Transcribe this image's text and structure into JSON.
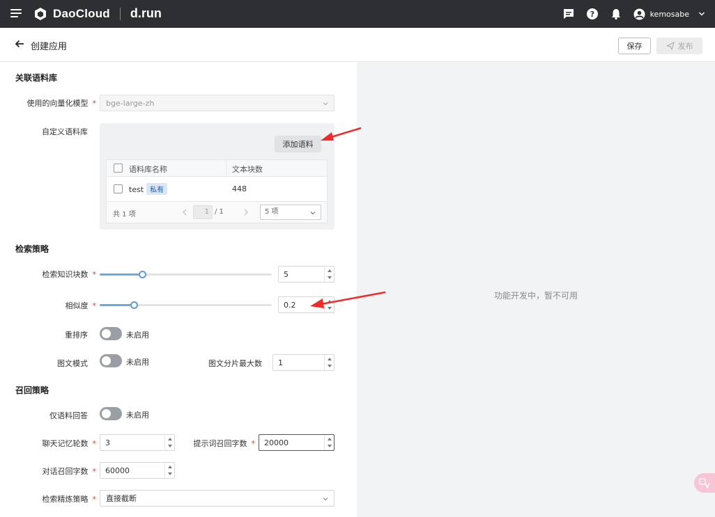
{
  "topbar": {
    "brand": "DaoCloud",
    "product": "d.run",
    "username": "kemosabe"
  },
  "header": {
    "title": "创建应用",
    "save_label": "保存",
    "publish_label": "发布"
  },
  "corpus": {
    "section_title": "关联语料库",
    "embed_label": "使用的向量化模型",
    "embed_value": "bge-large-zh",
    "custom_label": "自定义语料库",
    "add_button": "添加语料",
    "columns": [
      "语料库名称",
      "文本块数"
    ],
    "rows": [
      {
        "name": "test",
        "badge": "私有",
        "chunks": "448"
      }
    ],
    "total": "共 1 项",
    "page_current": "1",
    "page_total": "/ 1",
    "page_size": "5 项"
  },
  "retrieval": {
    "section_title": "检索策略",
    "chunks_label": "检索知识块数",
    "chunks_value": "5",
    "chunks_slider_fraction": 0.2,
    "similarity_label": "相似度",
    "similarity_value": "0.2",
    "similarity_slider_fraction": 0.2,
    "rerank_label": "重排序",
    "rerank_state": "未启用",
    "image_mode_label": "图文模式",
    "image_mode_state": "未启用",
    "image_max_label": "图文分片最大数",
    "image_max_value": "1"
  },
  "recall": {
    "section_title": "召回策略",
    "only_corpus_label": "仅语料回答",
    "only_corpus_state": "未启用",
    "memory_label": "聊天记忆轮数",
    "memory_value": "3",
    "prompt_chars_label": "提示词召回字数",
    "prompt_chars_value": "20000",
    "dialog_chars_label": "对话召回字数",
    "dialog_chars_value": "60000",
    "refine_label": "检索精炼策略",
    "refine_value": "直接截断"
  },
  "right_panel": {
    "message": "功能开发中，暂不可用"
  },
  "colors": {
    "topbar": "#2e2f33",
    "accent": "#5a9be0",
    "annotation_arrow": "#ef2b2b"
  }
}
